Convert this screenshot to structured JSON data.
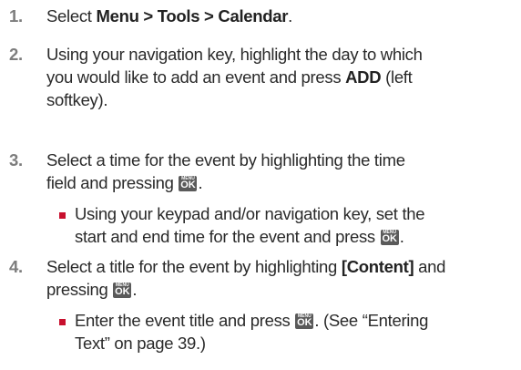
{
  "steps": [
    {
      "number": "1.",
      "pre": "Select ",
      "bold": "Menu > Tools > Calendar",
      "post": "."
    },
    {
      "number": "2.",
      "line1": "Using your navigation key, highlight the day to which",
      "line2_pre": "you would like to add an event and press ",
      "line2_bold": "ADD",
      "line2_post": " (left",
      "line3": "softkey)."
    },
    {
      "number": "3.",
      "line1": "Select a time for the event by highlighting the time",
      "line2_pre": "field and pressing ",
      "line2_post": ".",
      "bullet_line1": "Using your keypad and/or navigation key, set the",
      "bullet_line2_pre": "start and end time for the event and press ",
      "bullet_line2_post": "."
    },
    {
      "number": "4.",
      "line1_pre": "Select a title for the event by highlighting ",
      "line1_bold": "[Content]",
      "line1_post": " and",
      "line2_pre": "pressing ",
      "line2_post": ".",
      "bullet_line1_pre": "Enter the event title and press ",
      "bullet_line1_post": ". (See “Entering",
      "bullet_line2": "Text” on page 39.)"
    }
  ],
  "key": {
    "top": "MENU",
    "main": "OK"
  },
  "colors": {
    "step_number": "#7d7d7d",
    "bullet": "#c8102e",
    "key_background": "#5a5a5a"
  }
}
